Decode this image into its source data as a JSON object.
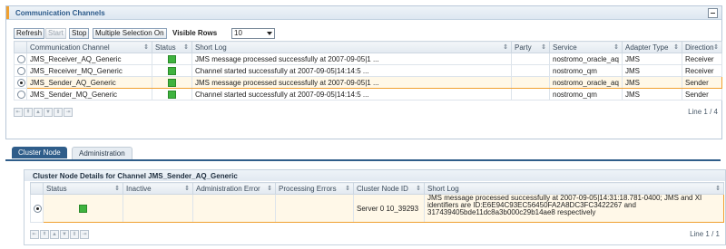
{
  "panel": {
    "title": "Communication Channels"
  },
  "toolbar": {
    "refresh_label": "Refresh",
    "start_label": "Start",
    "stop_label": "Stop",
    "multi_label": "Multiple Selection On",
    "visible_rows_label": "Visible Rows",
    "visible_rows_value": "10"
  },
  "channels": {
    "columns": [
      "Communication Channel",
      "Status",
      "Short Log",
      "Party",
      "Service",
      "Adapter Type",
      "Direction"
    ],
    "rows": [
      {
        "channel": "JMS_Receiver_AQ_Generic",
        "log": "JMS message processed successfully at 2007-09-05|1 ...",
        "party": "",
        "service": "nostromo_oracle_aq",
        "adapter": "JMS",
        "direction": "Receiver"
      },
      {
        "channel": "JMS_Receiver_MQ_Generic",
        "log": "Channel started successfully at 2007-09-05|14:14:5 ...",
        "party": "",
        "service": "nostromo_qm",
        "adapter": "JMS",
        "direction": "Receiver"
      },
      {
        "channel": "JMS_Sender_AQ_Generic",
        "log": "JMS message processed successfully at 2007-09-05|1 ...",
        "party": "",
        "service": "nostromo_oracle_aq",
        "adapter": "JMS",
        "direction": "Sender"
      },
      {
        "channel": "JMS_Sender_MQ_Generic",
        "log": "Channel started successfully at 2007-09-05|14:14:5 ...",
        "party": "",
        "service": "nostromo_qm",
        "adapter": "JMS",
        "direction": "Sender"
      }
    ],
    "line_info": "Line 1 / 4"
  },
  "tabs": [
    {
      "label": "Cluster Node"
    },
    {
      "label": "Administration"
    }
  ],
  "details": {
    "title": "Cluster Node Details for Channel JMS_Sender_AQ_Generic",
    "columns": [
      "Status",
      "Inactive",
      "Administration Error",
      "Processing Errors",
      "Cluster Node ID",
      "Short Log"
    ],
    "row": {
      "inactive": "",
      "admin_error": "",
      "processing_errors": "",
      "node_id": "Server 0 10_39293",
      "log_line1": "JMS message processed successfully at 2007-09-05|14:31:18.781-0400; JMS and XI",
      "log_line2": "identifiers are ID:E6E94C93EC56450FA2A8DC3FC3422267 and",
      "log_line3": "317439405bde11dc8a3b000c29b14ae8 respectively"
    },
    "line_info": "Line 1 / 1"
  },
  "colors": {
    "accent": "#f0a030",
    "header_text": "#2c5a8a",
    "status_ok": "#3fb33f",
    "tab_active": "#2f5d8a"
  }
}
